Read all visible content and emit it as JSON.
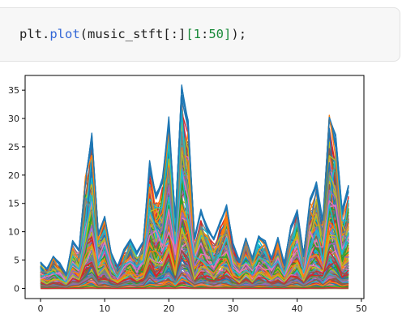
{
  "code_cell": {
    "tokens": [
      {
        "text": "plt.",
        "kind": "plain"
      },
      {
        "text": "plot",
        "kind": "fn"
      },
      {
        "text": "(music_stft[:]",
        "kind": "plain"
      },
      {
        "text": "[",
        "kind": "br"
      },
      {
        "text": "1",
        "kind": "num"
      },
      {
        "text": ":",
        "kind": "plain"
      },
      {
        "text": "50",
        "kind": "num"
      },
      {
        "text": "]",
        "kind": "br"
      },
      {
        "text": ");",
        "kind": "plain"
      }
    ]
  },
  "chart_data": {
    "type": "line",
    "title": "",
    "xlabel": "",
    "ylabel": "",
    "xlim": [
      -2.4,
      50.4
    ],
    "ylim": [
      -1.8,
      37.6
    ],
    "xticks": [
      0,
      10,
      20,
      30,
      40,
      50
    ],
    "yticks": [
      0,
      5,
      10,
      15,
      20,
      25,
      30,
      35
    ],
    "grid": false,
    "legend": "none",
    "x": [
      0,
      1,
      2,
      3,
      4,
      5,
      6,
      7,
      8,
      9,
      10,
      11,
      12,
      13,
      14,
      15,
      16,
      17,
      18,
      19,
      20,
      21,
      22,
      23,
      24,
      25,
      26,
      27,
      28,
      29,
      30,
      31,
      32,
      33,
      34,
      35,
      36,
      37,
      38,
      39,
      40,
      41,
      42,
      43,
      44,
      45,
      46,
      47,
      48
    ],
    "envelope": [
      4.7,
      3.5,
      5.8,
      4.5,
      2.5,
      8.5,
      7.0,
      20.0,
      27.5,
      10.0,
      13.0,
      6.5,
      4.0,
      7.0,
      9.0,
      6.5,
      8.5,
      22.5,
      17.0,
      20.0,
      30.5,
      12.5,
      36.3,
      30.0,
      9.0,
      14.0,
      11.0,
      9.0,
      12.0,
      15.3,
      8.0,
      5.0,
      9.0,
      5.5,
      9.5,
      8.5,
      5.5,
      9.0,
      4.5,
      11.0,
      14.0,
      6.0,
      16.0,
      19.0,
      12.0,
      31.0,
      27.0,
      14.0,
      18.5
    ],
    "series_count": 260,
    "colors": [
      "#1f77b4",
      "#ff7f0e",
      "#2ca02c",
      "#d62728",
      "#9467bd",
      "#8c564b",
      "#e377c2",
      "#7f7f7f",
      "#bcbd22",
      "#17becf"
    ]
  }
}
